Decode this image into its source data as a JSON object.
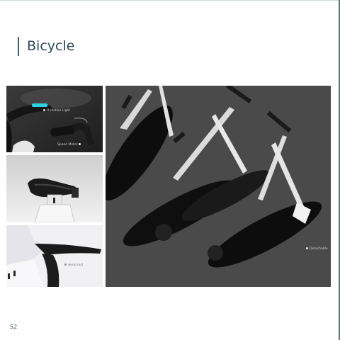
{
  "page": {
    "title": "Bicycle",
    "page_number": "52"
  },
  "photos": {
    "handlebar": {
      "caption_1": "Direction Light",
      "caption_2": "Speed Meter"
    },
    "saddle": {},
    "frame_detail": {
      "caption": "Aerocrest"
    },
    "assembly": {
      "caption": "Detachable"
    }
  },
  "colors": {
    "accent": "#3c5a6a",
    "led": "#2fd0e0"
  }
}
